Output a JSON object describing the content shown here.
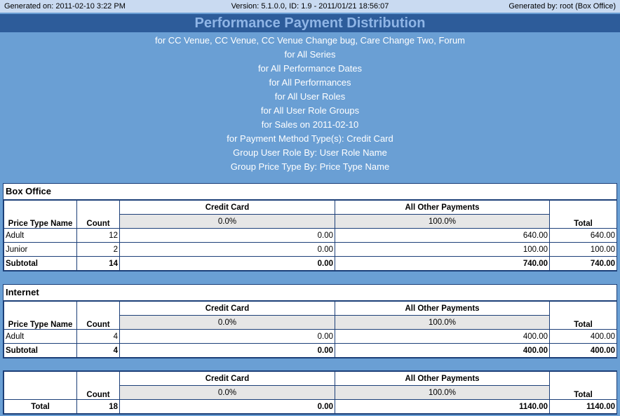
{
  "header": {
    "generated_on": "Generated on: 2011-02-10 3:22 PM",
    "version": "Version: 5.1.0.0, ID: 1.9 - 2011/01/21 18:56:07",
    "generated_by": "Generated by: root (Box Office)"
  },
  "report": {
    "title": "Performance Payment Distribution",
    "params": [
      "for CC Venue, CC Venue, CC Venue Change bug, Care Change Two, Forum",
      "for All Series",
      "for All Performance Dates",
      "for All Performances",
      "for All User Roles",
      "for All User Role Groups",
      "for Sales on 2011-02-10",
      "for Payment Method Type(s): Credit Card",
      "Group User Role By: User Role Name",
      "Group Price Type By: Price Type Name"
    ]
  },
  "columns": {
    "price_type_name": "Price Type Name",
    "count": "Count",
    "credit_card": "Credit Card",
    "credit_card_pct": "0.0%",
    "other": "All Other Payments",
    "other_pct": "100.0%",
    "total": "Total"
  },
  "sections": [
    {
      "title": "Box Office",
      "rows": [
        {
          "name": "Adult",
          "count": "12",
          "cc": "0.00",
          "other": "640.00",
          "total": "640.00"
        },
        {
          "name": "Junior",
          "count": "2",
          "cc": "0.00",
          "other": "100.00",
          "total": "100.00"
        }
      ],
      "subtotal": {
        "label": "Subtotal",
        "count": "14",
        "cc": "0.00",
        "other": "740.00",
        "total": "740.00"
      }
    },
    {
      "title": "Internet",
      "rows": [
        {
          "name": "Adult",
          "count": "4",
          "cc": "0.00",
          "other": "400.00",
          "total": "400.00"
        }
      ],
      "subtotal": {
        "label": "Subtotal",
        "count": "4",
        "cc": "0.00",
        "other": "400.00",
        "total": "400.00"
      }
    }
  ],
  "grand_total": {
    "label": "Total",
    "count": "18",
    "cc": "0.00",
    "other": "1140.00",
    "total": "1140.00"
  }
}
